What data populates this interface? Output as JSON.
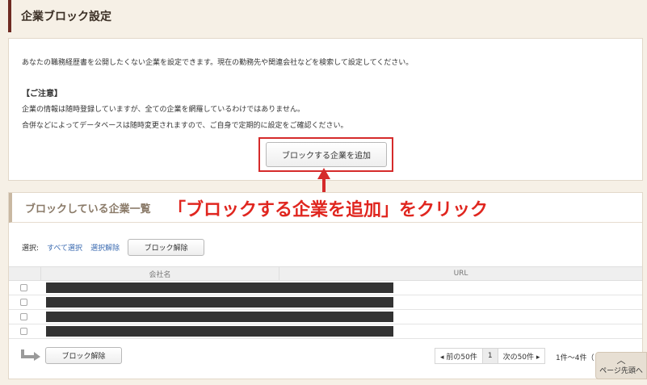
{
  "page": {
    "title": "企業ブロック設定"
  },
  "intro": {
    "description": "あなたの職務経歴書を公開したくない企業を設定できます。現在の勤務先や関連会社などを検索して設定してください。",
    "notice_heading": "【ご注意】",
    "notice_line1": "企業の情報は随時登録していますが、全ての企業を網羅しているわけではありません。",
    "notice_line2": "合併などによってデータベースは随時変更されますので、ご自身で定期的に設定をご確認ください。",
    "add_button": "ブロックする企業を追加"
  },
  "annotation": {
    "callout": "「ブロックする企業を追加」をクリック",
    "color": "#e0261f"
  },
  "blocked_list": {
    "title": "ブロックしている企業一覧",
    "select_label": "選択:",
    "select_all": "すべて選択",
    "deselect": "選択解除",
    "unblock_button": "ブロック解除",
    "columns": [
      "会社名",
      "URL"
    ],
    "row_count": 4
  },
  "pagination": {
    "prev": "◂ 前の50件",
    "current": "1",
    "next": "次の50件 ▸",
    "count": "1件〜4件（"
  },
  "back_to_top": "ページ先頭へ"
}
